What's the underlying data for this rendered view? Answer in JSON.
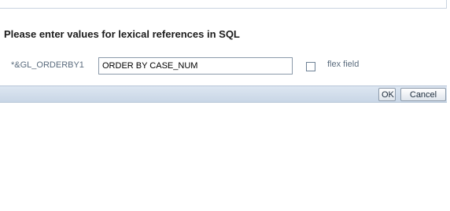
{
  "dialog": {
    "heading": "Please enter values for lexical references in SQL",
    "field": {
      "label": "*&GL_ORDERBY1",
      "value": "ORDER BY CASE_NUM"
    },
    "flex_checkbox": {
      "label": "flex field",
      "checked": false
    },
    "buttons": {
      "ok": "OK",
      "cancel": "Cancel"
    }
  }
}
